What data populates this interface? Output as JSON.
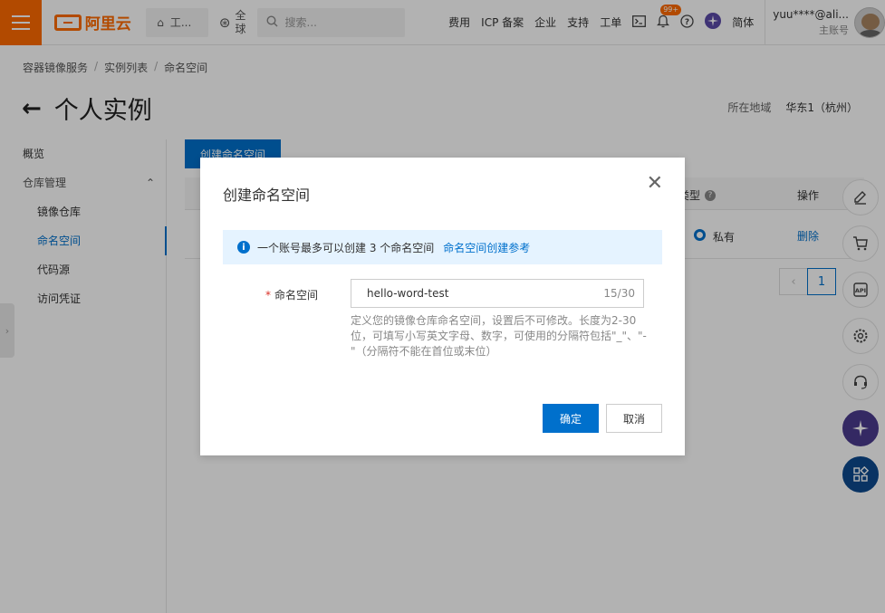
{
  "topbar": {
    "logo_text": "阿里云",
    "workbench_label": "工...",
    "region_label_line1": "全",
    "region_label_line2": "球",
    "search_placeholder": "搜索...",
    "links": [
      "费用",
      "ICP 备案",
      "企业",
      "支持",
      "工单"
    ],
    "notification_badge": "99+",
    "language": "简体",
    "user_name": "yuu****@ali...",
    "user_sub": "主账号"
  },
  "breadcrumb": [
    "容器镜像服务",
    "实例列表",
    "命名空间"
  ],
  "page": {
    "title": "个人实例",
    "region_label": "所在地域",
    "region_value": "华东1（杭州）"
  },
  "sidenav": {
    "overview": "概览",
    "repo_management": "仓库管理",
    "items": [
      "镜像仓库",
      "命名空间",
      "代码源",
      "访问凭证"
    ],
    "active_item": "命名空间"
  },
  "main": {
    "create_button": "创建命名空间",
    "col_type": "类型",
    "col_op": "操作",
    "row_type": "私有",
    "row_op": "删除",
    "page_current": "1"
  },
  "dialog": {
    "title": "创建命名空间",
    "notice_text": "一个账号最多可以创建 3 个命名空间",
    "notice_link": "命名空间创建参考",
    "field_label": "命名空间",
    "field_value": "hello-word-test",
    "field_count": "15/30",
    "help_text": "定义您的镜像仓库命名空间，设置后不可修改。长度为2-30位，可填写小写英文字母、数字，可使用的分隔符包括\"_\"、\"-\"（分隔符不能在首位或末位）",
    "ok_button": "确定",
    "cancel_button": "取消"
  },
  "colors": {
    "brand": "#ff6a00",
    "primary": "#0070cc",
    "notice_bg": "#e5f3ff"
  }
}
